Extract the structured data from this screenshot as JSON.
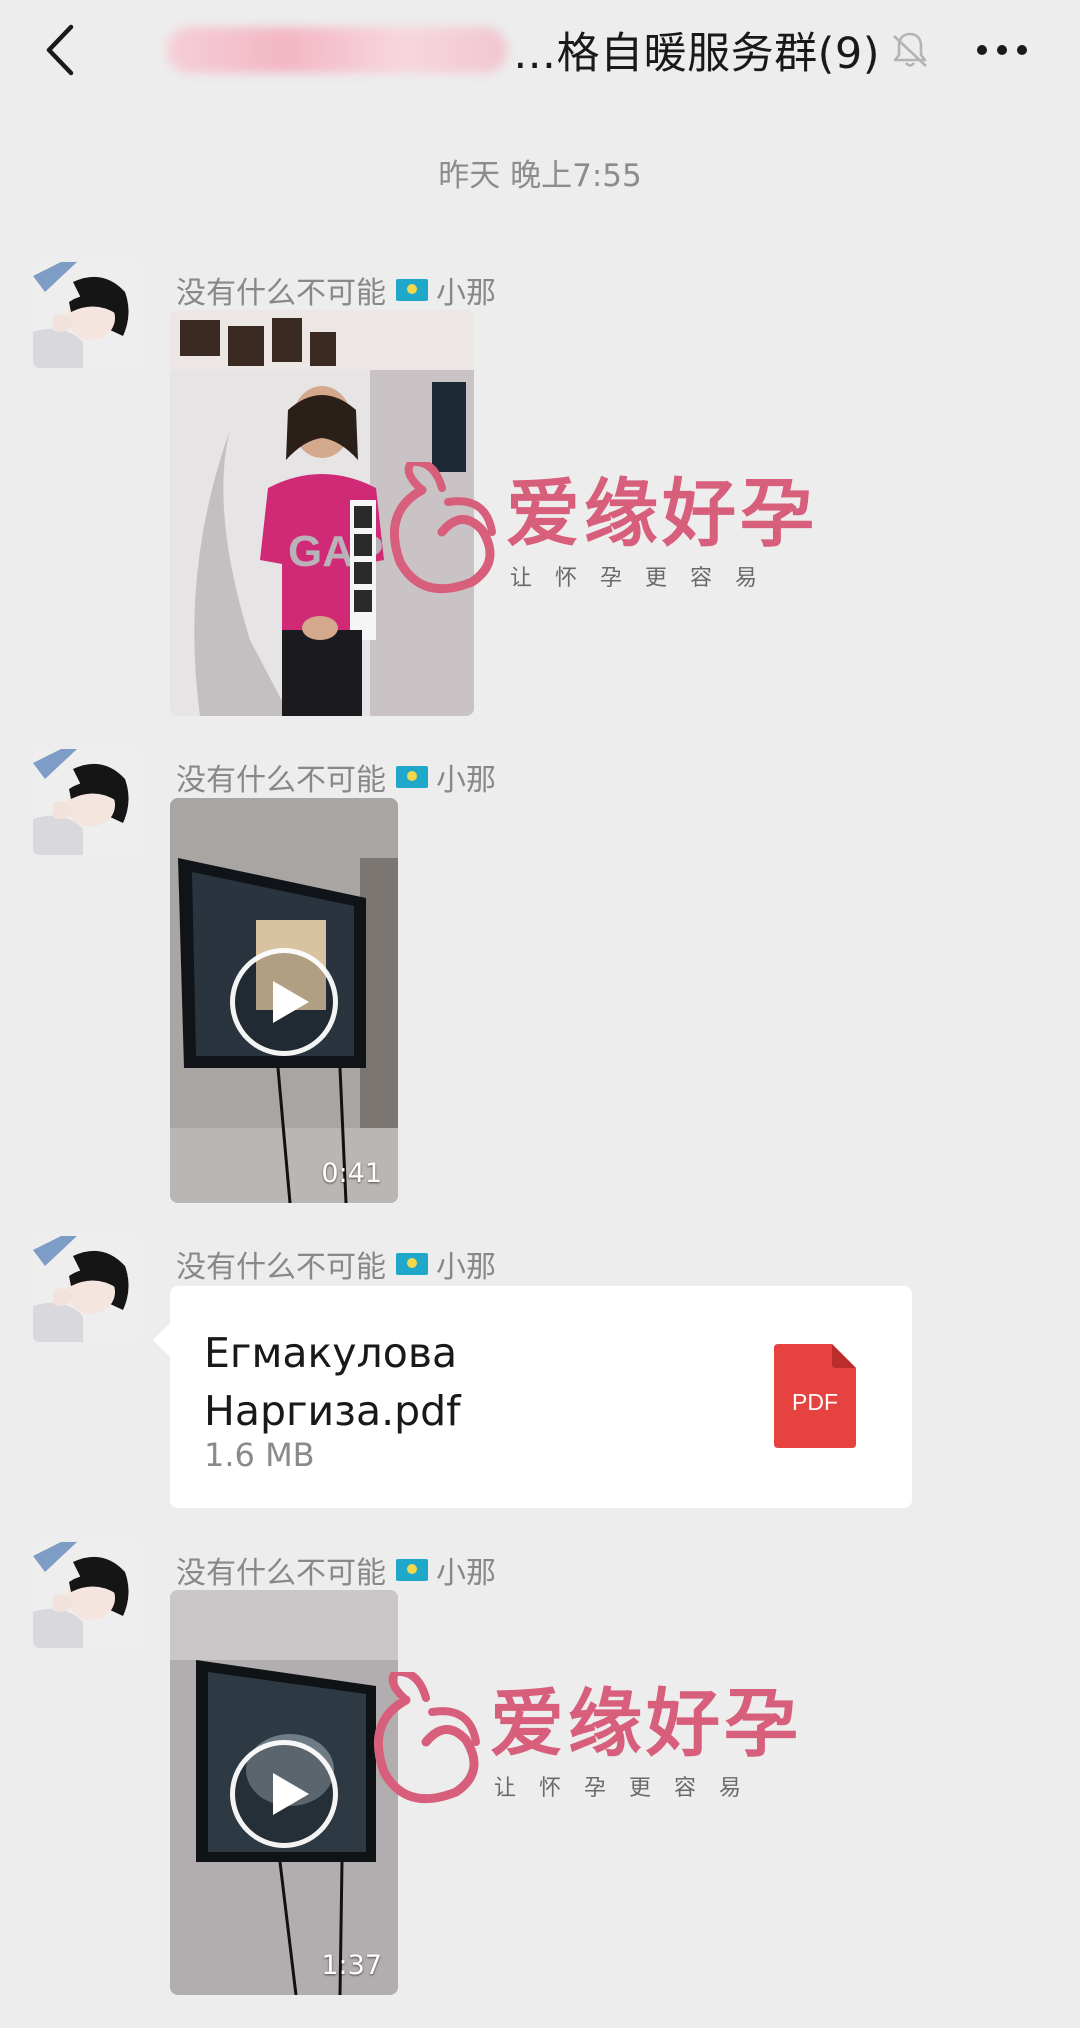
{
  "nav": {
    "title": "…格自暖服务群(9)",
    "back_icon": "chevron-left-icon",
    "mute_icon": "bell-muted-icon",
    "more_icon": "more-dots-icon"
  },
  "timestamp": "昨天 晚上7:55",
  "messages": [
    {
      "sender": "没有什么不可能",
      "sender_suffix": "小那",
      "type": "image"
    },
    {
      "sender": "没有什么不可能",
      "sender_suffix": "小那",
      "type": "video",
      "duration": "0:41"
    },
    {
      "sender": "没有什么不可能",
      "sender_suffix": "小那",
      "type": "file",
      "file_name": "Егмакулова Наргиза.pdf",
      "file_size": "1.6 MB",
      "file_type": "PDF"
    },
    {
      "sender": "没有什么不可能",
      "sender_suffix": "小那",
      "type": "video",
      "duration": "1:37"
    }
  ],
  "watermark": {
    "main": "爱缘好孕",
    "sub": "让怀孕更容易"
  },
  "colors": {
    "background": "#ededed",
    "watermark": "#d85f7c",
    "pdf": "#e64340"
  }
}
